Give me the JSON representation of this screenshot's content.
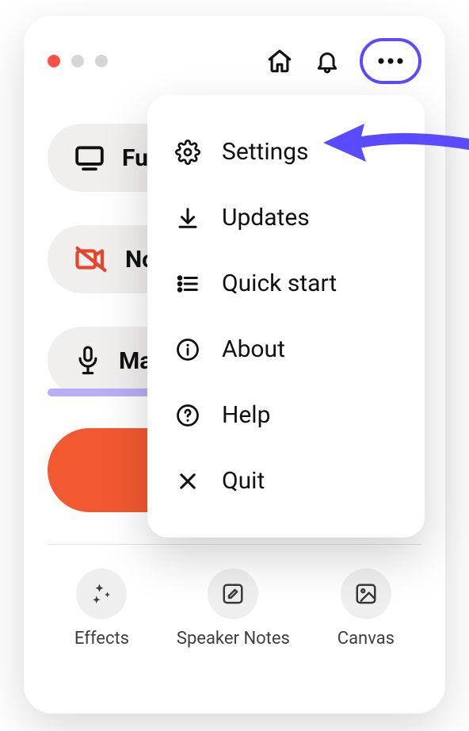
{
  "traffic_lights": [
    "red",
    "grey",
    "grey"
  ],
  "pills": {
    "full": "Fu",
    "no": "No",
    "mac": "Ma"
  },
  "menu": {
    "settings": "Settings",
    "updates": "Updates",
    "quick_start": "Quick start",
    "about": "About",
    "help": "Help",
    "quit": "Quit"
  },
  "bottom": {
    "effects": "Effects",
    "speaker_notes": "Speaker Notes",
    "canvas": "Canvas"
  }
}
